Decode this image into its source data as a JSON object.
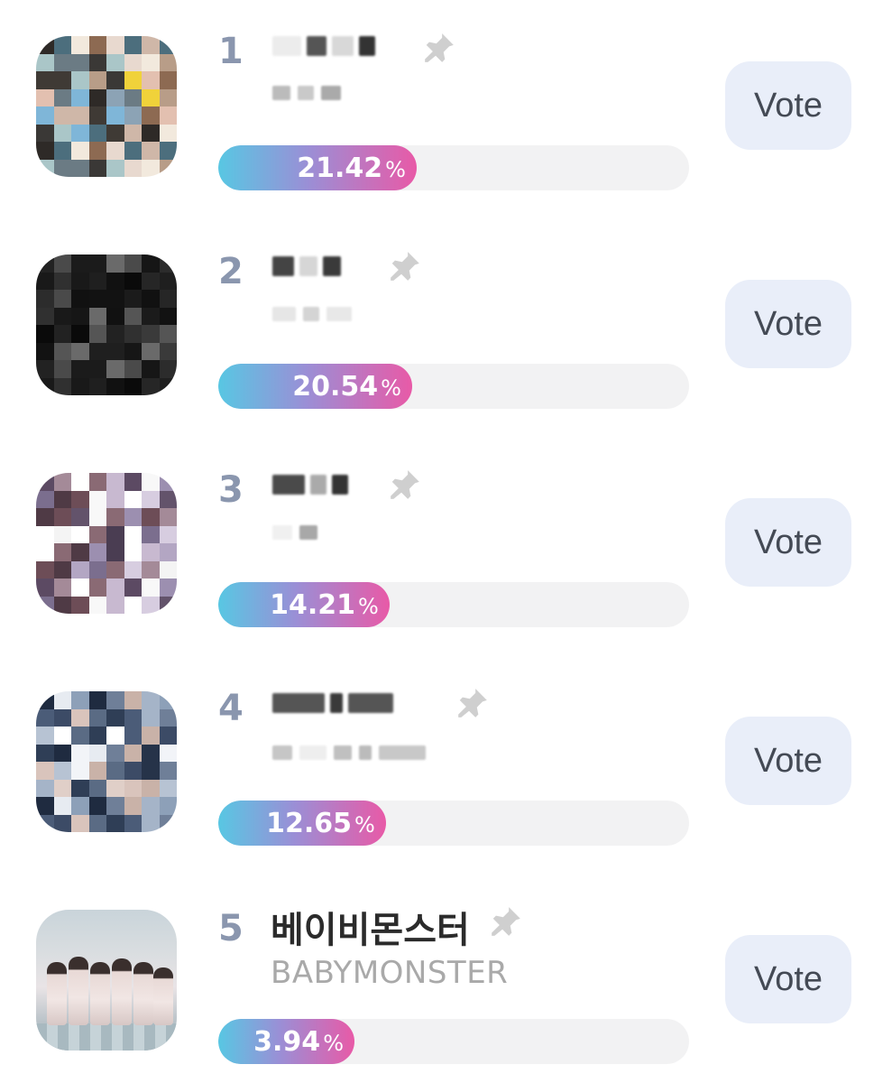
{
  "ranking": [
    {
      "rank": "1",
      "name": "",
      "subname": "",
      "percent": "21.42",
      "percent_sign": "%",
      "fraction": 0.4214,
      "vote_label": "Vote",
      "pin_icon": "pin-icon",
      "avatar": "blurred-image"
    },
    {
      "rank": "2",
      "name": "",
      "subname": "",
      "percent": "20.54",
      "percent_sign": "%",
      "fraction": 0.4118,
      "vote_label": "Vote",
      "pin_icon": "pin-icon",
      "avatar": "blurred-image"
    },
    {
      "rank": "3",
      "name": "",
      "subname": "",
      "percent": "14.21",
      "percent_sign": "%",
      "fraction": 0.3637,
      "vote_label": "Vote",
      "pin_icon": "pin-icon",
      "avatar": "blurred-image"
    },
    {
      "rank": "4",
      "name": "",
      "subname": "",
      "percent": "12.65",
      "percent_sign": "%",
      "fraction": 0.356,
      "vote_label": "Vote",
      "pin_icon": "pin-icon",
      "avatar": "blurred-image"
    },
    {
      "rank": "5",
      "name": "베이비몬스터",
      "subname": "BABYMONSTER",
      "percent": "3.94",
      "percent_sign": "%",
      "fraction": 0.2893,
      "vote_label": "Vote",
      "pin_icon": "pin-icon",
      "avatar": "group-photo"
    }
  ],
  "colors": {
    "bar_start": "#58c7e3",
    "bar_end": "#e85aa7",
    "track": "#f2f2f3",
    "vote_bg": "#e9eef9",
    "rank": "#8a96ae"
  }
}
